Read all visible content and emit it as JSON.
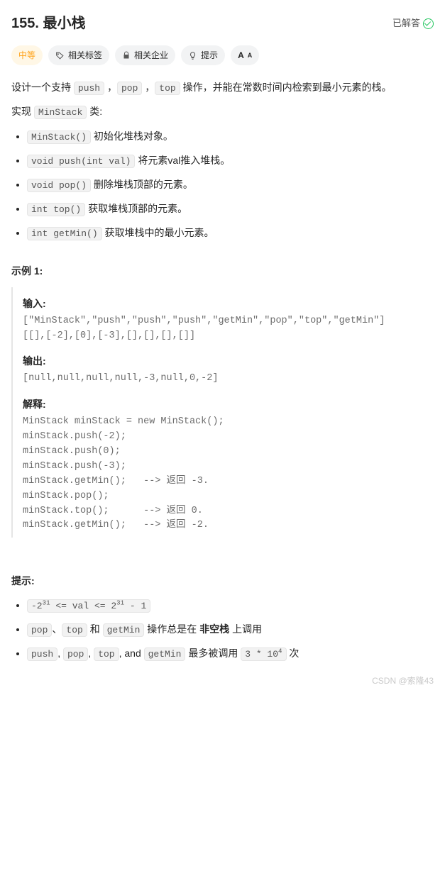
{
  "header": {
    "title": "155. 最小栈",
    "solved_label": "已解答"
  },
  "tags": {
    "difficulty": "中等",
    "related_tags": "相关标签",
    "related_companies": "相关企业",
    "hint": "提示"
  },
  "description": {
    "p1_a": "设计一个支持 ",
    "p1_c1": "push",
    "p1_b": " ，",
    "p1_c2": "pop",
    "p1_c": " ，",
    "p1_c3": "top",
    "p1_d": " 操作，并能在常数时间内检索到最小元素的栈。",
    "p2_a": "实现 ",
    "p2_c1": "MinStack",
    "p2_b": " 类:"
  },
  "methods": {
    "m1_code": "MinStack()",
    "m1_text": " 初始化堆栈对象。",
    "m2_code": "void push(int val)",
    "m2_text": " 将元素val推入堆栈。",
    "m3_code": "void pop()",
    "m3_text": " 删除堆栈顶部的元素。",
    "m4_code": "int top()",
    "m4_text": " 获取堆栈顶部的元素。",
    "m5_code": "int getMin()",
    "m5_text": " 获取堆栈中的最小元素。"
  },
  "example": {
    "title": "示例 1:",
    "input_label": "输入:",
    "input_line1": "[\"MinStack\",\"push\",\"push\",\"push\",\"getMin\",\"pop\",\"top\",\"getMin\"]",
    "input_line2": "[[],[-2],[0],[-3],[],[],[],[]]",
    "output_label": "输出:",
    "output_line": "[null,null,null,null,-3,null,0,-2]",
    "explain_label": "解释:",
    "explain_body": "MinStack minStack = new MinStack();\nminStack.push(-2);\nminStack.push(0);\nminStack.push(-3);\nminStack.getMin();   --> 返回 -3.\nminStack.pop();\nminStack.top();      --> 返回 0.\nminStack.getMin();   --> 返回 -2."
  },
  "constraints": {
    "title": "提示:",
    "c1_pre": "-2",
    "c1_sup1": "31",
    "c1_mid": " <= val <= 2",
    "c1_sup2": "31",
    "c1_post": " - 1",
    "c2_code1": "pop",
    "c2_sep1": "、",
    "c2_code2": "top",
    "c2_sep2": " 和 ",
    "c2_code3": "getMin",
    "c2_text1": " 操作总是在 ",
    "c2_bold": "非空栈",
    "c2_text2": " 上调用",
    "c3_code1": "push",
    "c3_s1": ", ",
    "c3_code2": "pop",
    "c3_s2": ", ",
    "c3_code3": "top",
    "c3_s3": ", and ",
    "c3_code4": "getMin",
    "c3_text1": " 最多被调用 ",
    "c3_val_a": "3 * 10",
    "c3_val_sup": "4",
    "c3_text2": " 次"
  },
  "watermark": "CSDN @索隆43"
}
